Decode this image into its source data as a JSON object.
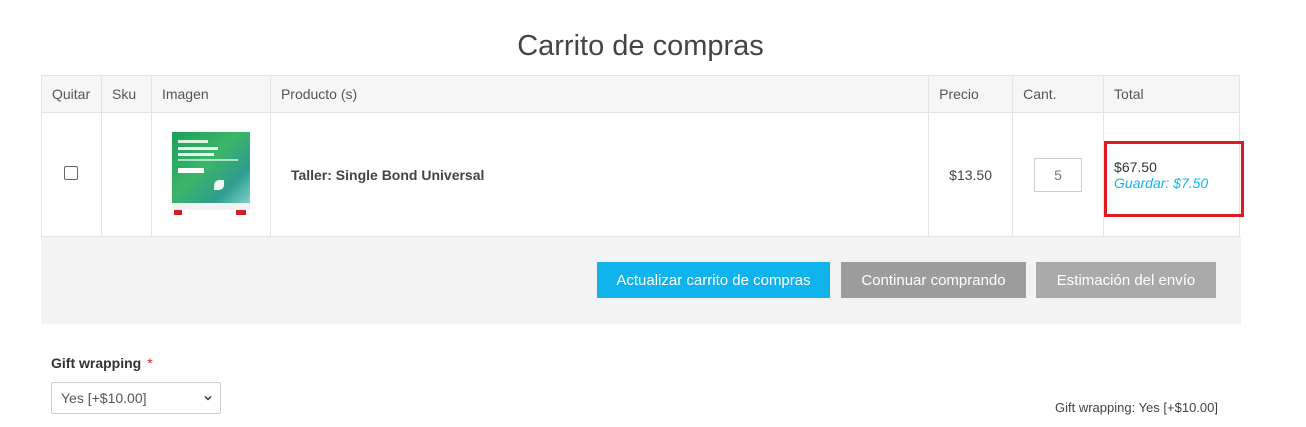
{
  "page_title": "Carrito de compras",
  "table": {
    "headers": [
      "Quitar",
      "Sku",
      "Imagen",
      "Producto (s)",
      "Precio",
      "Cant.",
      "Total"
    ],
    "row": {
      "sku": "",
      "product": "Taller: Single Bond Universal",
      "price": "$13.50",
      "qty": "5",
      "total": "$67.50",
      "save": "Guardar: $7.50"
    }
  },
  "buttons": {
    "update": "Actualizar carrito de compras",
    "continue": "Continuar comprando",
    "estimate": "Estimación del envío"
  },
  "gift": {
    "label": "Gift wrapping",
    "required_mark": "*",
    "selected": "Yes [+$10.00]",
    "summary": "Gift wrapping: Yes [+$10.00]"
  },
  "colors": {
    "accent": "#10b3ec",
    "highlight": "#e01a22",
    "save_text": "#11b6e6"
  }
}
